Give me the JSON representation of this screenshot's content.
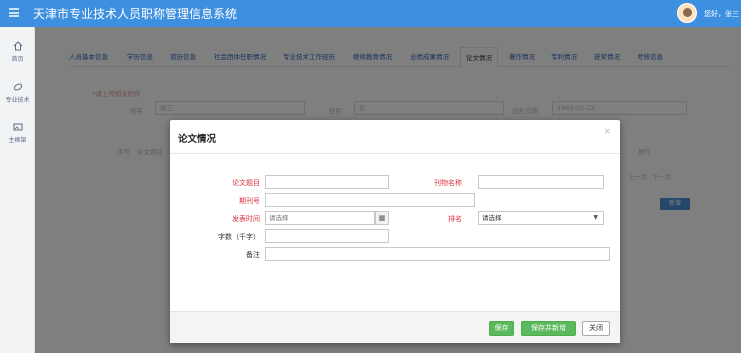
{
  "header": {
    "title": "天津市专业技术人员职称管理信息系统",
    "greeting": "您好，张三"
  },
  "sidebar": {
    "items": [
      {
        "label": "首页",
        "icon": "home-icon"
      },
      {
        "label": "专业技术",
        "icon": "leaf-icon"
      },
      {
        "label": "主框架",
        "icon": "image-icon"
      }
    ]
  },
  "tabs": [
    {
      "label": "人员基本信息"
    },
    {
      "label": "学历信息"
    },
    {
      "label": "资历信息"
    },
    {
      "label": "社会团体任职情况"
    },
    {
      "label": "专业技术工作经历"
    },
    {
      "label": "继续教育情况"
    },
    {
      "label": "业绩成果情况"
    },
    {
      "label": "论文情况",
      "active": true
    },
    {
      "label": "著作情况"
    },
    {
      "label": "专利情况"
    },
    {
      "label": "获奖情况"
    },
    {
      "label": "考核信息"
    }
  ],
  "background_form": {
    "note": "*请上传相关附件",
    "name_label": "姓名",
    "name_value": "张三",
    "gender_label": "性别",
    "gender_value": "女",
    "birth_label": "出生日期",
    "birth_value": "1983-10-22",
    "col_index": "序号",
    "col_title": "论文题目",
    "col_action": "操作",
    "prev_page": "上一页",
    "next_page": "下一页",
    "add_label": "新增"
  },
  "modal": {
    "title": "论文情况",
    "close_symbol": "×",
    "fields": {
      "paper_title_label": "论文题目",
      "paper_title_value": "",
      "journal_label": "刊物名称",
      "journal_value": "",
      "issue_label": "期刊号",
      "issue_value": "",
      "pub_time_label": "发表时间",
      "pub_time_placeholder": "请选择",
      "rank_label": "排名",
      "rank_selected": "请选择",
      "words_label": "字数（千字）",
      "words_value": "",
      "remark_label": "备注",
      "remark_value": ""
    },
    "buttons": {
      "save": "保存",
      "save_new": "保存并新增",
      "close": "关闭"
    }
  },
  "colors": {
    "header_bg": "#3d8fe0",
    "required_label": "#d9313d",
    "green_button": "#5cb85c"
  }
}
